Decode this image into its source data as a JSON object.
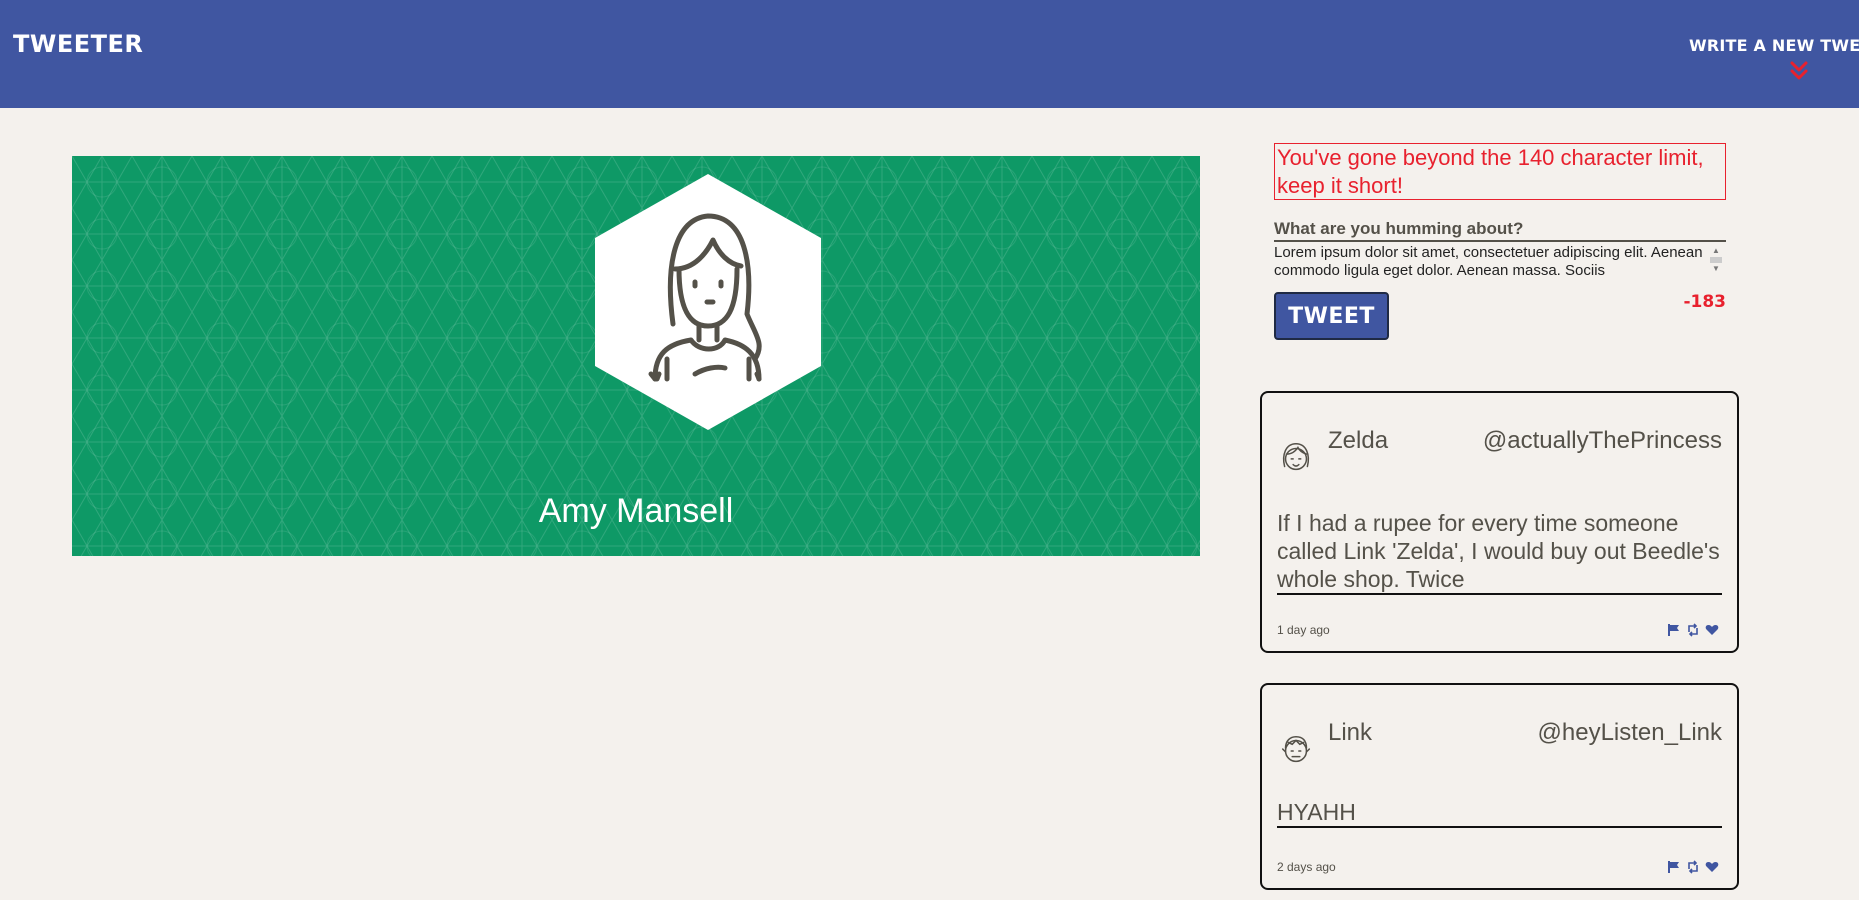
{
  "header": {
    "brand": "Tweeter",
    "compose_label": "Write a new tweet",
    "compose_icon": "double-chevron-down-icon",
    "colors": {
      "bar": "#4056a1",
      "chevron": "#e8212e"
    }
  },
  "profile": {
    "name": "Amy Mansell",
    "avatar_icon": "woman-avatar-icon",
    "banner_color": "#0e9966"
  },
  "composer": {
    "error": "You've gone beyond the 140 character limit, keep it short!",
    "question": "What are you humming about?",
    "text": "Lorem ipsum dolor sit amet, consectetuer adipiscing elit. Aenean commodo ligula eget dolor. Aenean massa. Sociis",
    "tweet_button": "Tweet",
    "counter": "-183",
    "error_color": "#e8212e"
  },
  "tweets": [
    {
      "name": "Zelda",
      "handle": "@actuallyThePrincess",
      "text": "If I had a rupee for every time someone called Link 'Zelda', I would buy out Beedle's whole shop. Twice",
      "time": "1 day ago",
      "avatar_icon": "girl-avatar-icon",
      "actions": [
        "flag-icon",
        "retweet-icon",
        "heart-icon"
      ]
    },
    {
      "name": "Link",
      "handle": "@heyListen_Link",
      "text": "HYAHH",
      "time": "2 days ago",
      "avatar_icon": "boy-avatar-icon",
      "actions": [
        "flag-icon",
        "retweet-icon",
        "heart-icon"
      ]
    }
  ],
  "action_color": "#4056a1"
}
